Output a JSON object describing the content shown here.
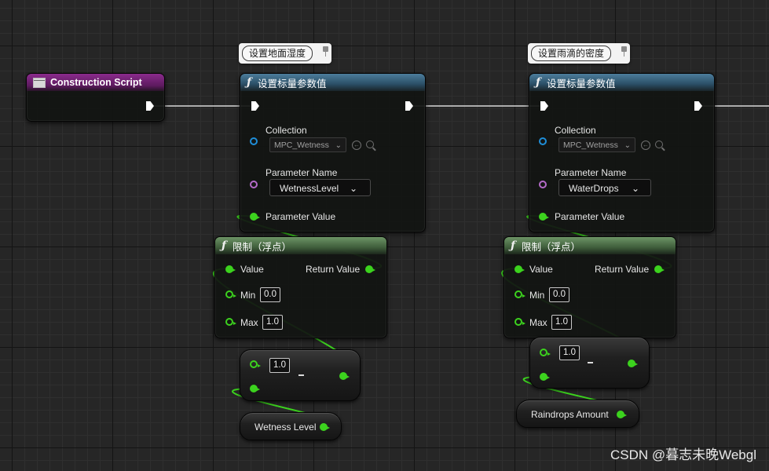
{
  "canvas": {
    "background": "#262626",
    "wire_color": "#3cd21e",
    "exec_wire_color": "#ffffff"
  },
  "construction_script": {
    "title": "Construction Script",
    "header_color": "#8a2b8c"
  },
  "wetness_group": {
    "comment": "设置地面湿度",
    "set_node": {
      "title": "设置标量参数值",
      "collection_label": "Collection",
      "collection_value": "MPC_Wetness",
      "parameter_name_label": "Parameter Name",
      "parameter_name_value": "WetnessLevel",
      "parameter_value_label": "Parameter Value"
    },
    "clamp_node": {
      "title": "限制（浮点）",
      "value_label": "Value",
      "return_label": "Return Value",
      "min_label": "Min",
      "min_value": "0.0",
      "max_label": "Max",
      "max_value": "1.0"
    },
    "subtract_node": {
      "a_value": "1.0",
      "operator": "-"
    },
    "variable_node": {
      "label": "Wetness Level"
    }
  },
  "raindrops_group": {
    "comment": "设置雨滴的密度",
    "set_node": {
      "title": "设置标量参数值",
      "collection_label": "Collection",
      "collection_value": "MPC_Wetness",
      "parameter_name_label": "Parameter Name",
      "parameter_name_value": "WaterDrops",
      "parameter_value_label": "Parameter Value"
    },
    "clamp_node": {
      "title": "限制（浮点）",
      "value_label": "Value",
      "return_label": "Return Value",
      "min_label": "Min",
      "min_value": "0.0",
      "max_label": "Max",
      "max_value": "1.0"
    },
    "subtract_node": {
      "a_value": "1.0",
      "operator": "-"
    },
    "variable_node": {
      "label": "Raindrops Amount"
    }
  },
  "icons": {
    "function": "ƒ",
    "collection_browse": "←"
  },
  "watermark": "CSDN @暮志未晚Webgl"
}
